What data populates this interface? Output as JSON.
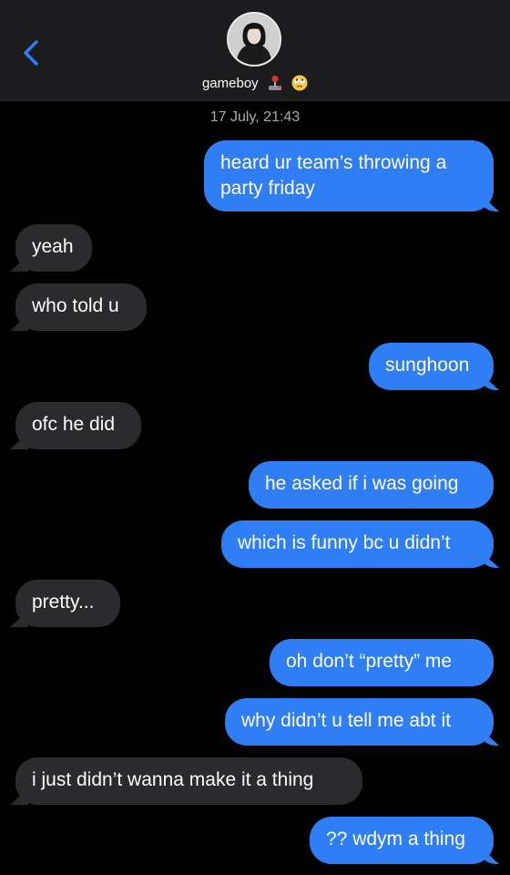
{
  "header": {
    "contact_name": "gameboy",
    "emoji_icons": [
      "joystick-icon",
      "rolling-eyes-emoji"
    ],
    "back_icon": "chevron-left-icon"
  },
  "thread": {
    "timestamp": "17 July, 21:43"
  },
  "messages": [
    {
      "from": "me",
      "text": "heard ur team’s throwing a",
      "text2": "party friday"
    },
    {
      "from": "them",
      "text": "yeah"
    },
    {
      "from": "them",
      "text": "who told u"
    },
    {
      "from": "me",
      "text": "sunghoon"
    },
    {
      "from": "them",
      "text": "ofc he did"
    },
    {
      "from": "me",
      "text": "he asked if i was going"
    },
    {
      "from": "me",
      "text": "which is funny bc u didn’t"
    },
    {
      "from": "them",
      "text": "pretty..."
    },
    {
      "from": "me",
      "text": "oh don’t “pretty” me"
    },
    {
      "from": "me",
      "text": "why didn’t u tell me abt it"
    },
    {
      "from": "them",
      "text": "i just didn’t wanna make it a thing"
    },
    {
      "from": "me",
      "text": "?? wdym a thing"
    }
  ],
  "colors": {
    "sent_bubble": "#2f7ef6",
    "received_bubble": "#2b2b2d",
    "background": "#000000",
    "accent": "#2f7ef6"
  }
}
